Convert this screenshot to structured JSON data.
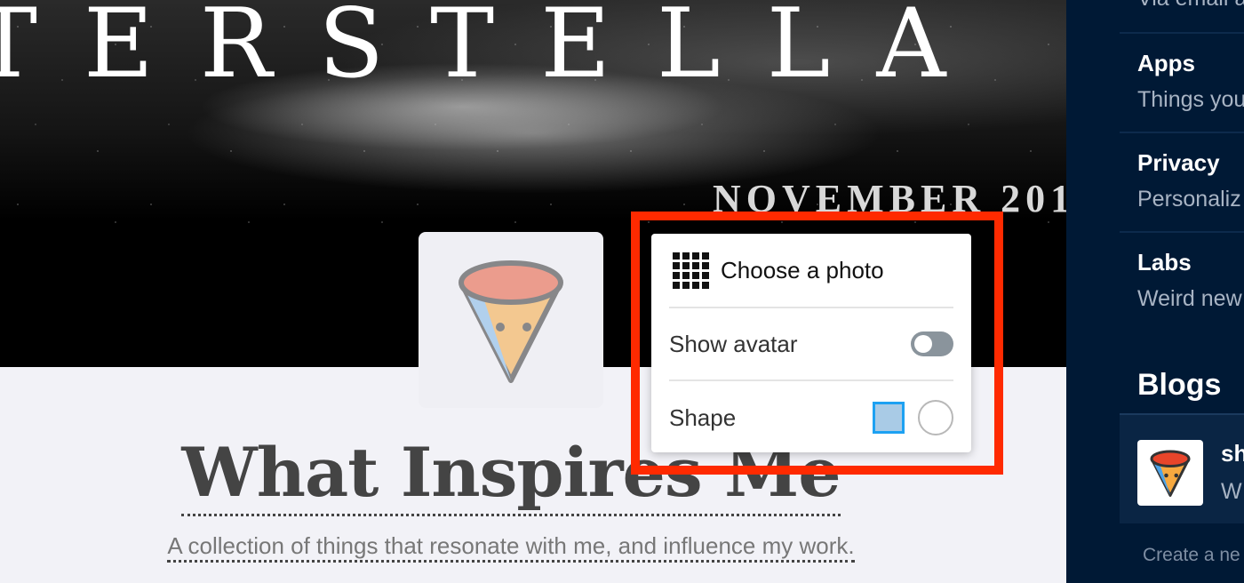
{
  "header": {
    "movie_title": "TERSTELLA",
    "movie_date": "NOVEMBER 201"
  },
  "blog": {
    "title": "What Inspires Me",
    "description": "A collection of things that resonate with me, and influence my work."
  },
  "avatar_menu": {
    "choose_photo_label": "Choose a photo",
    "show_avatar_label": "Show avatar",
    "show_avatar_enabled": false,
    "shape_label": "Shape",
    "shape_options": [
      "square",
      "circle"
    ],
    "shape_selected": "square",
    "icons": {
      "choose_photo": "grid-icon"
    }
  },
  "sidebar": {
    "top_partial_sub": "Via email a",
    "items": [
      {
        "title": "Apps",
        "subtitle": "Things you"
      },
      {
        "title": "Privacy",
        "subtitle": "Personaliz"
      },
      {
        "title": "Labs",
        "subtitle": "Weird new"
      }
    ],
    "blogs_heading": "Blogs",
    "blog_entry": {
      "name": "sh",
      "subtitle": "W"
    },
    "create_link": "Create a ne"
  },
  "colors": {
    "highlight": "#ff2a00",
    "sidebar_bg": "#001935",
    "shape_selected_border": "#1da1f2",
    "shape_selected_fill": "#a9cbe6"
  }
}
